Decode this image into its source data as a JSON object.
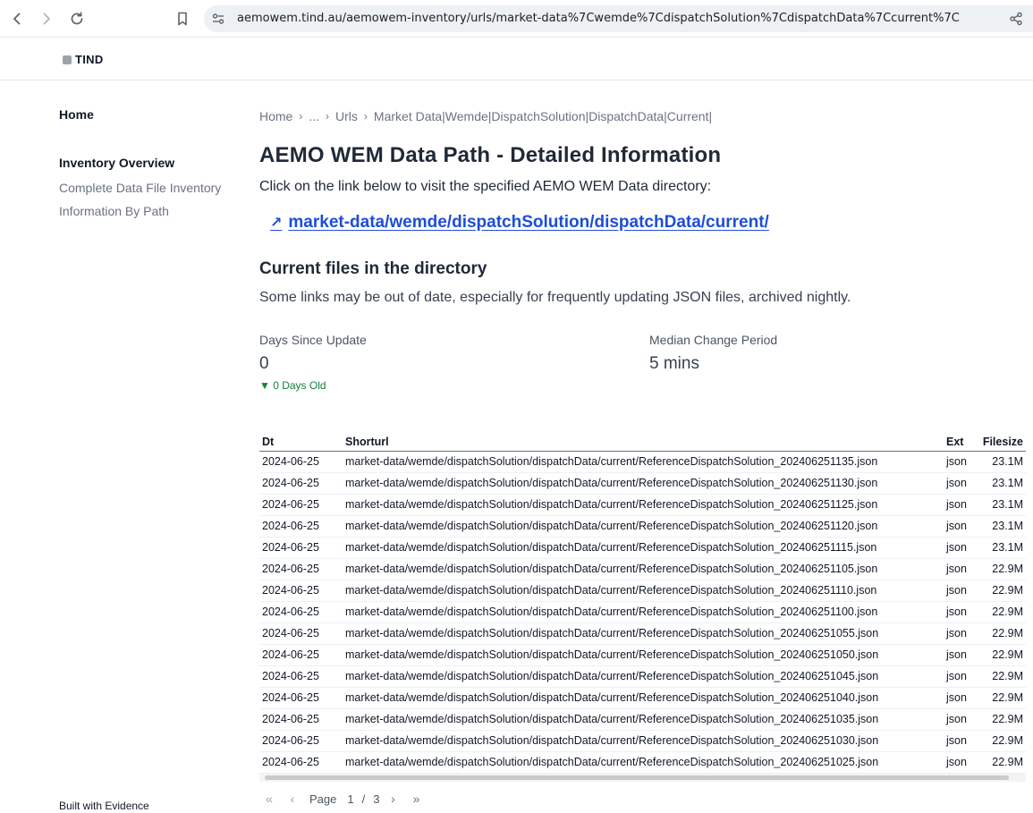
{
  "browser": {
    "url": "aemowem.tind.au/aemowem-inventory/urls/market-data%7Cwemde%7CdispatchSolution%7CdispatchData%7Ccurrent%7C"
  },
  "site": {
    "logo_text": "TIND"
  },
  "sidebar": {
    "home": "Home",
    "section": "Inventory Overview",
    "links": [
      "Complete Data File Inventory",
      "Information By Path"
    ],
    "footer": "Built with Evidence"
  },
  "breadcrumb": [
    "Home",
    "...",
    "Urls",
    "Market Data|Wemde|DispatchSolution|DispatchData|Current|"
  ],
  "page": {
    "title": "AEMO WEM Data Path - Detailed Information",
    "intro": "Click on the link below to visit the specified AEMO WEM Data directory:",
    "dir_link": "market-data/wemde/dispatchSolution/dispatchData/current/",
    "section_title": "Current files in the directory",
    "section_note": "Some links may be out of date, especially for frequently updating JSON files, archived nightly."
  },
  "stats": {
    "days_since_update": {
      "label": "Days Since Update",
      "value": "0",
      "delta": "▼ 0 Days Old"
    },
    "median_change": {
      "label": "Median Change Period",
      "value": "5 mins"
    }
  },
  "table": {
    "headers": {
      "dt": "Dt",
      "shorturl": "Shorturl",
      "ext": "Ext",
      "filesize": "Filesize"
    },
    "rows": [
      [
        "2024-06-25",
        "market-data/wemde/dispatchSolution/dispatchData/current/ReferenceDispatchSolution_202406251135.json",
        "json",
        "23.1M"
      ],
      [
        "2024-06-25",
        "market-data/wemde/dispatchSolution/dispatchData/current/ReferenceDispatchSolution_202406251130.json",
        "json",
        "23.1M"
      ],
      [
        "2024-06-25",
        "market-data/wemde/dispatchSolution/dispatchData/current/ReferenceDispatchSolution_202406251125.json",
        "json",
        "23.1M"
      ],
      [
        "2024-06-25",
        "market-data/wemde/dispatchSolution/dispatchData/current/ReferenceDispatchSolution_202406251120.json",
        "json",
        "23.1M"
      ],
      [
        "2024-06-25",
        "market-data/wemde/dispatchSolution/dispatchData/current/ReferenceDispatchSolution_202406251115.json",
        "json",
        "23.1M"
      ],
      [
        "2024-06-25",
        "market-data/wemde/dispatchSolution/dispatchData/current/ReferenceDispatchSolution_202406251105.json",
        "json",
        "22.9M"
      ],
      [
        "2024-06-25",
        "market-data/wemde/dispatchSolution/dispatchData/current/ReferenceDispatchSolution_202406251110.json",
        "json",
        "22.9M"
      ],
      [
        "2024-06-25",
        "market-data/wemde/dispatchSolution/dispatchData/current/ReferenceDispatchSolution_202406251100.json",
        "json",
        "22.9M"
      ],
      [
        "2024-06-25",
        "market-data/wemde/dispatchSolution/dispatchData/current/ReferenceDispatchSolution_202406251055.json",
        "json",
        "22.9M"
      ],
      [
        "2024-06-25",
        "market-data/wemde/dispatchSolution/dispatchData/current/ReferenceDispatchSolution_202406251050.json",
        "json",
        "22.9M"
      ],
      [
        "2024-06-25",
        "market-data/wemde/dispatchSolution/dispatchData/current/ReferenceDispatchSolution_202406251045.json",
        "json",
        "22.9M"
      ],
      [
        "2024-06-25",
        "market-data/wemde/dispatchSolution/dispatchData/current/ReferenceDispatchSolution_202406251040.json",
        "json",
        "22.9M"
      ],
      [
        "2024-06-25",
        "market-data/wemde/dispatchSolution/dispatchData/current/ReferenceDispatchSolution_202406251035.json",
        "json",
        "22.9M"
      ],
      [
        "2024-06-25",
        "market-data/wemde/dispatchSolution/dispatchData/current/ReferenceDispatchSolution_202406251030.json",
        "json",
        "22.9M"
      ],
      [
        "2024-06-25",
        "market-data/wemde/dispatchSolution/dispatchData/current/ReferenceDispatchSolution_202406251025.json",
        "json",
        "22.9M"
      ]
    ]
  },
  "pager": {
    "page_label": "Page",
    "current": "1",
    "separator": "/",
    "total": "3"
  },
  "colors": {
    "link": "#1d4ed8",
    "delta_green": "#15803d",
    "muted": "#6b7280"
  },
  "icons": [
    "back-arrow-icon",
    "forward-arrow-icon",
    "reload-icon",
    "bookmark-icon",
    "site-settings-icon",
    "share-icon",
    "external-link-arrow-icon",
    "first-page-icon",
    "prev-page-icon",
    "next-page-icon",
    "last-page-icon"
  ]
}
